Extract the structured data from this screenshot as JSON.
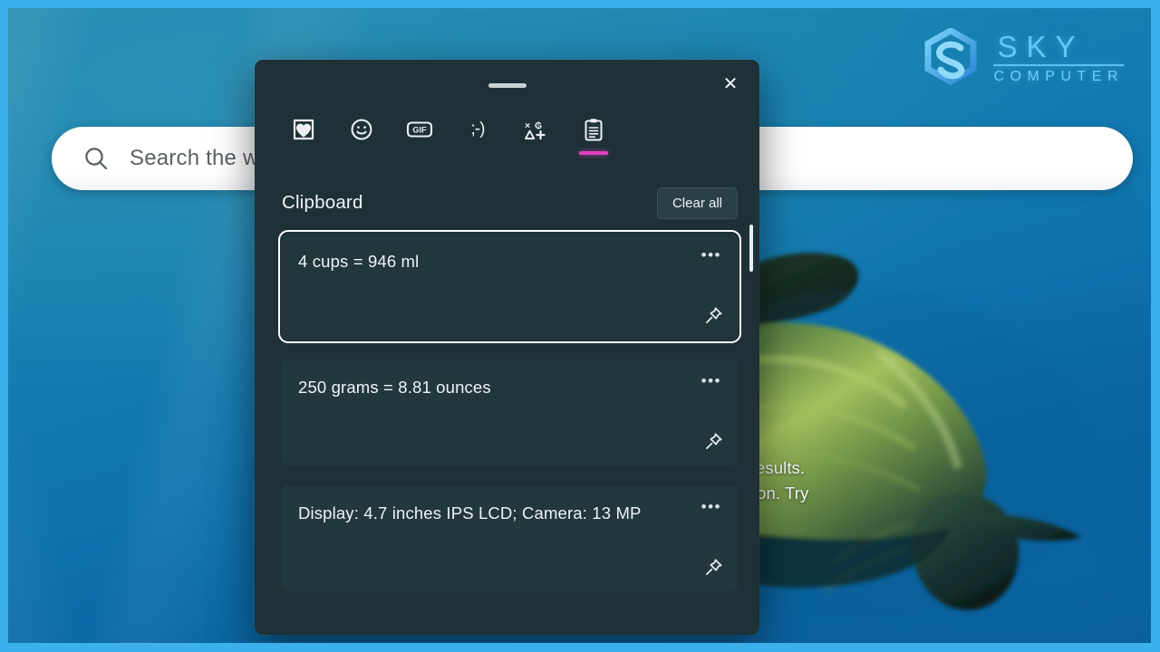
{
  "wallpaper": {
    "copy_line1": "stions. Refine results.",
    "copy_line2": "reative inspiration. Try",
    "turtle_alt": "sea-turtle"
  },
  "logo": {
    "mark": "sky-hexagon-s-mark",
    "name": "SKY",
    "subtitle": "COMPUTER",
    "color": "#63c8f5"
  },
  "search": {
    "icon": "search-icon",
    "text": "Search the w"
  },
  "panel": {
    "titlebar": {
      "drag_handle": "drag-handle",
      "close_label": "✕"
    },
    "toolbar": {
      "items": [
        {
          "id": "recently-used",
          "icon": "image-heart-icon",
          "label": "Recently used",
          "active": false
        },
        {
          "id": "emoji",
          "icon": "smiley-face-icon",
          "label": "Emoji",
          "active": false
        },
        {
          "id": "gif",
          "icon": "gif-icon",
          "label": "GIF",
          "active": false
        },
        {
          "id": "kaomoji",
          "icon": "kaomoji-icon",
          "label": ";-)",
          "active": false
        },
        {
          "id": "symbols",
          "icon": "symbols-icon",
          "label": "Symbols",
          "active": false
        },
        {
          "id": "clipboard",
          "icon": "clipboard-icon",
          "label": "Clipboard",
          "active": true
        }
      ],
      "active_indicator_color": "#e040c0"
    },
    "list": {
      "title": "Clipboard",
      "clear_all_label": "Clear all",
      "items": [
        {
          "text": "4 cups = 946 ml",
          "more": "•••",
          "pin": "pin-icon",
          "focused": true
        },
        {
          "text": "250 grams =  8.81 ounces",
          "more": "•••",
          "pin": "pin-icon",
          "focused": false
        },
        {
          "text": "Display: 4.7 inches IPS LCD; Camera: 13 MP",
          "more": "•••",
          "pin": "pin-icon",
          "focused": false
        }
      ]
    }
  },
  "colors": {
    "frame": "#3bb0ea",
    "panel_bg": "#1e3136",
    "card_bg": "#23383c",
    "accent": "#e040c0"
  }
}
